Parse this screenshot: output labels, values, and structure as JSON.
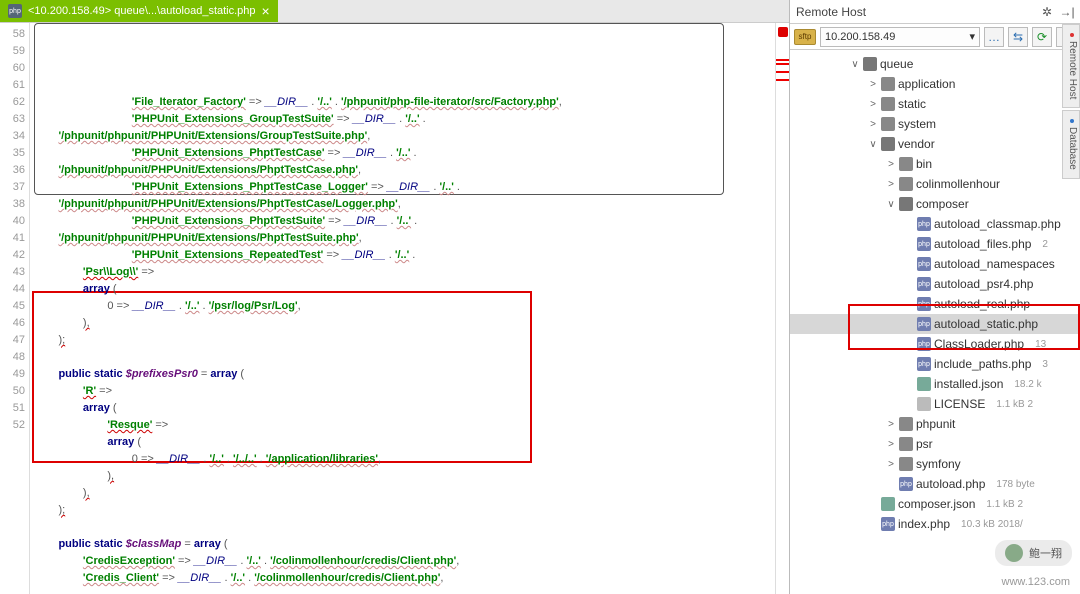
{
  "tab": {
    "label": "<10.200.158.49> queue\\...\\autoload_static.php",
    "icon": "php"
  },
  "gutter_lines": [
    "58",
    "59",
    "",
    "60",
    "",
    "61",
    "",
    "62",
    "",
    "63",
    "34",
    "35",
    "36",
    "37",
    "38",
    "",
    "40",
    "41",
    "42",
    "43",
    "44",
    "45",
    "46",
    "47",
    "48",
    "49",
    "50",
    "51",
    "52"
  ],
  "code_lines": [
    {
      "indent": 8,
      "parts": [
        [
          "k-str",
          "'File_Iterator_Factory'"
        ],
        [
          "k-op",
          " => "
        ],
        [
          "k-dir",
          "__DIR__"
        ],
        [
          "k-op",
          " . "
        ],
        [
          "k-str",
          "'/..'"
        ],
        [
          "k-op",
          " . "
        ],
        [
          "k-str",
          "'/phpunit/php-file-iterator/src/Factory.php'"
        ],
        [
          "k-op",
          ","
        ]
      ]
    },
    {
      "indent": 8,
      "parts": [
        [
          "k-str",
          "'PHPUnit_Extensions_GroupTestSuite'"
        ],
        [
          "k-op",
          " => "
        ],
        [
          "k-dir",
          "__DIR__"
        ],
        [
          "k-op",
          " . "
        ],
        [
          "k-str",
          "'/..'"
        ],
        [
          "k-op",
          " . "
        ]
      ]
    },
    {
      "indent": 2,
      "parts": [
        [
          "k-str",
          "'/phpunit/phpunit/PHPUnit/Extensions/GroupTestSuite.php'"
        ],
        [
          "k-op",
          ","
        ]
      ]
    },
    {
      "indent": 8,
      "parts": [
        [
          "k-str",
          "'PHPUnit_Extensions_PhptTestCase'"
        ],
        [
          "k-op",
          " => "
        ],
        [
          "k-dir",
          "__DIR__"
        ],
        [
          "k-op",
          " . "
        ],
        [
          "k-str",
          "'/..'"
        ],
        [
          "k-op",
          " . "
        ]
      ]
    },
    {
      "indent": 2,
      "parts": [
        [
          "k-str",
          "'/phpunit/phpunit/PHPUnit/Extensions/PhptTestCase.php'"
        ],
        [
          "k-op",
          ","
        ]
      ]
    },
    {
      "indent": 8,
      "parts": [
        [
          "k-str",
          "'PHPUnit_Extensions_PhptTestCase_Logger'"
        ],
        [
          "k-op",
          " => "
        ],
        [
          "k-dir",
          "__DIR__"
        ],
        [
          "k-op",
          " . "
        ],
        [
          "k-str",
          "'/..'"
        ],
        [
          "k-op",
          " . "
        ]
      ]
    },
    {
      "indent": 2,
      "parts": [
        [
          "k-str",
          "'/phpunit/phpunit/PHPUnit/Extensions/PhptTestCase/Logger.php'"
        ],
        [
          "k-op",
          ","
        ]
      ]
    },
    {
      "indent": 8,
      "parts": [
        [
          "k-str",
          "'PHPUnit_Extensions_PhptTestSuite'"
        ],
        [
          "k-op",
          " => "
        ],
        [
          "k-dir",
          "__DIR__"
        ],
        [
          "k-op",
          " . "
        ],
        [
          "k-str",
          "'/..'"
        ],
        [
          "k-op",
          " . "
        ]
      ]
    },
    {
      "indent": 2,
      "parts": [
        [
          "k-str",
          "'/phpunit/phpunit/PHPUnit/Extensions/PhptTestSuite.php'"
        ],
        [
          "k-op",
          ","
        ]
      ]
    },
    {
      "indent": 8,
      "parts": [
        [
          "k-str",
          "'PHPUnit_Extensions_RepeatedTest'"
        ],
        [
          "k-op",
          " => "
        ],
        [
          "k-dir",
          "__DIR__"
        ],
        [
          "k-op",
          " . "
        ],
        [
          "k-str",
          "'/..'"
        ],
        [
          "k-op",
          " . "
        ]
      ]
    },
    {
      "indent": 4,
      "parts": [
        [
          "k-str wavy",
          "'Psr\\\\Log\\\\'"
        ],
        [
          "k-op",
          " => "
        ]
      ]
    },
    {
      "indent": 4,
      "parts": [
        [
          "k-kw",
          "array"
        ],
        [
          "k-op",
          " ("
        ]
      ]
    },
    {
      "indent": 6,
      "parts": [
        [
          "k-op",
          "0 => "
        ],
        [
          "k-dir",
          "__DIR__"
        ],
        [
          "k-op",
          " . "
        ],
        [
          "k-str",
          "'/..'"
        ],
        [
          "k-op",
          " . "
        ],
        [
          "k-str",
          "'/psr/log/Psr/Log'"
        ],
        [
          "k-op",
          ","
        ]
      ]
    },
    {
      "indent": 4,
      "parts": [
        [
          "k-op wavy",
          "),"
        ]
      ]
    },
    {
      "indent": 2,
      "parts": [
        [
          "k-op wavy",
          ");"
        ]
      ]
    },
    {
      "indent": 0,
      "parts": [
        [
          "",
          ""
        ]
      ]
    },
    {
      "indent": 2,
      "parts": [
        [
          "k-kw",
          "public static "
        ],
        [
          "k-var",
          "$prefixesPsr0"
        ],
        [
          "k-op",
          " = "
        ],
        [
          "k-kw",
          "array"
        ],
        [
          "k-op",
          " ("
        ]
      ]
    },
    {
      "indent": 4,
      "parts": [
        [
          "k-str wavy",
          "'R'"
        ],
        [
          "k-op",
          " => "
        ]
      ]
    },
    {
      "indent": 4,
      "parts": [
        [
          "k-kw",
          "array"
        ],
        [
          "k-op",
          " ("
        ]
      ]
    },
    {
      "indent": 6,
      "parts": [
        [
          "k-str wavy",
          "'Resque'"
        ],
        [
          "k-op",
          " => "
        ]
      ]
    },
    {
      "indent": 6,
      "parts": [
        [
          "k-kw",
          "array"
        ],
        [
          "k-op",
          " ("
        ]
      ]
    },
    {
      "indent": 8,
      "parts": [
        [
          "k-op",
          "0 => "
        ],
        [
          "k-dir",
          "__DIR__"
        ],
        [
          "k-op",
          " . "
        ],
        [
          "k-str",
          "'/..'"
        ],
        [
          "k-op",
          " . "
        ],
        [
          "k-str",
          "'/../..'"
        ],
        [
          "k-op",
          " . "
        ],
        [
          "k-str",
          "'/application/libraries'"
        ],
        [
          "k-op",
          ","
        ]
      ]
    },
    {
      "indent": 6,
      "parts": [
        [
          "k-op wavy",
          "),"
        ]
      ]
    },
    {
      "indent": 4,
      "parts": [
        [
          "k-op wavy",
          "),"
        ]
      ]
    },
    {
      "indent": 2,
      "parts": [
        [
          "k-op wavy",
          ");"
        ]
      ]
    },
    {
      "indent": 0,
      "parts": [
        [
          "",
          ""
        ]
      ]
    },
    {
      "indent": 2,
      "parts": [
        [
          "k-kw",
          "public static "
        ],
        [
          "k-var",
          "$classMap"
        ],
        [
          "k-op",
          " = "
        ],
        [
          "k-kw",
          "array"
        ],
        [
          "k-op",
          " ("
        ]
      ]
    },
    {
      "indent": 4,
      "parts": [
        [
          "k-str",
          "'CredisException'"
        ],
        [
          "k-op",
          " => "
        ],
        [
          "k-dir",
          "__DIR__"
        ],
        [
          "k-op",
          " . "
        ],
        [
          "k-str",
          "'/..'"
        ],
        [
          "k-op",
          " . "
        ],
        [
          "k-str",
          "'/colinmollenhour/credis/Client.php'"
        ],
        [
          "k-op",
          ","
        ]
      ]
    },
    {
      "indent": 4,
      "parts": [
        [
          "k-str",
          "'Credis_Client'"
        ],
        [
          "k-op",
          " => "
        ],
        [
          "k-dir",
          "__DIR__"
        ],
        [
          "k-op",
          " . "
        ],
        [
          "k-str",
          "'/..'"
        ],
        [
          "k-op",
          " . "
        ],
        [
          "k-str",
          "'/colinmollenhour/credis/Client.php'"
        ],
        [
          "k-op",
          ","
        ]
      ]
    }
  ],
  "remote": {
    "title": "Remote Host",
    "host": "10.200.158.49",
    "tree": [
      {
        "depth": 0,
        "arrow": "v",
        "icon": "diro",
        "label": "queue"
      },
      {
        "depth": 1,
        "arrow": "r",
        "icon": "dir",
        "label": "application"
      },
      {
        "depth": 1,
        "arrow": "r",
        "icon": "dir",
        "label": "static"
      },
      {
        "depth": 1,
        "arrow": "r",
        "icon": "dir",
        "label": "system"
      },
      {
        "depth": 1,
        "arrow": "v",
        "icon": "diro",
        "label": "vendor"
      },
      {
        "depth": 2,
        "arrow": "r",
        "icon": "dir",
        "label": "bin"
      },
      {
        "depth": 2,
        "arrow": "r",
        "icon": "dir",
        "label": "colinmollenhour"
      },
      {
        "depth": 2,
        "arrow": "v",
        "icon": "diro",
        "label": "composer"
      },
      {
        "depth": 3,
        "arrow": "n",
        "icon": "php",
        "label": "autoload_classmap.php"
      },
      {
        "depth": 3,
        "arrow": "n",
        "icon": "php",
        "label": "autoload_files.php",
        "meta": "2"
      },
      {
        "depth": 3,
        "arrow": "n",
        "icon": "php",
        "label": "autoload_namespaces"
      },
      {
        "depth": 3,
        "arrow": "n",
        "icon": "php",
        "label": "autoload_psr4.php"
      },
      {
        "depth": 3,
        "arrow": "n",
        "icon": "php",
        "label": "autoload_real.php"
      },
      {
        "depth": 3,
        "arrow": "n",
        "icon": "php",
        "label": "autoload_static.php",
        "sel": true
      },
      {
        "depth": 3,
        "arrow": "n",
        "icon": "php",
        "label": "ClassLoader.php",
        "meta": "13"
      },
      {
        "depth": 3,
        "arrow": "n",
        "icon": "php",
        "label": "include_paths.php",
        "meta": "3"
      },
      {
        "depth": 3,
        "arrow": "n",
        "icon": "json",
        "label": "installed.json",
        "meta": "18.2 k"
      },
      {
        "depth": 3,
        "arrow": "n",
        "icon": "txt",
        "label": "LICENSE",
        "meta": "1.1 kB    2"
      },
      {
        "depth": 2,
        "arrow": "r",
        "icon": "dir",
        "label": "phpunit"
      },
      {
        "depth": 2,
        "arrow": "r",
        "icon": "dir",
        "label": "psr"
      },
      {
        "depth": 2,
        "arrow": "r",
        "icon": "dir",
        "label": "symfony"
      },
      {
        "depth": 2,
        "arrow": "n",
        "icon": "php",
        "label": "autoload.php",
        "meta": "178 byte"
      },
      {
        "depth": 1,
        "arrow": "n",
        "icon": "json",
        "label": "composer.json",
        "meta": "1.1 kB   2"
      },
      {
        "depth": 1,
        "arrow": "n",
        "icon": "php",
        "label": "index.php",
        "meta": "10.3 kB   2018/"
      }
    ]
  },
  "watermark": "鲍一翔",
  "footer": "www.123.com",
  "side_tabs": [
    "Remote Host",
    "Database"
  ]
}
